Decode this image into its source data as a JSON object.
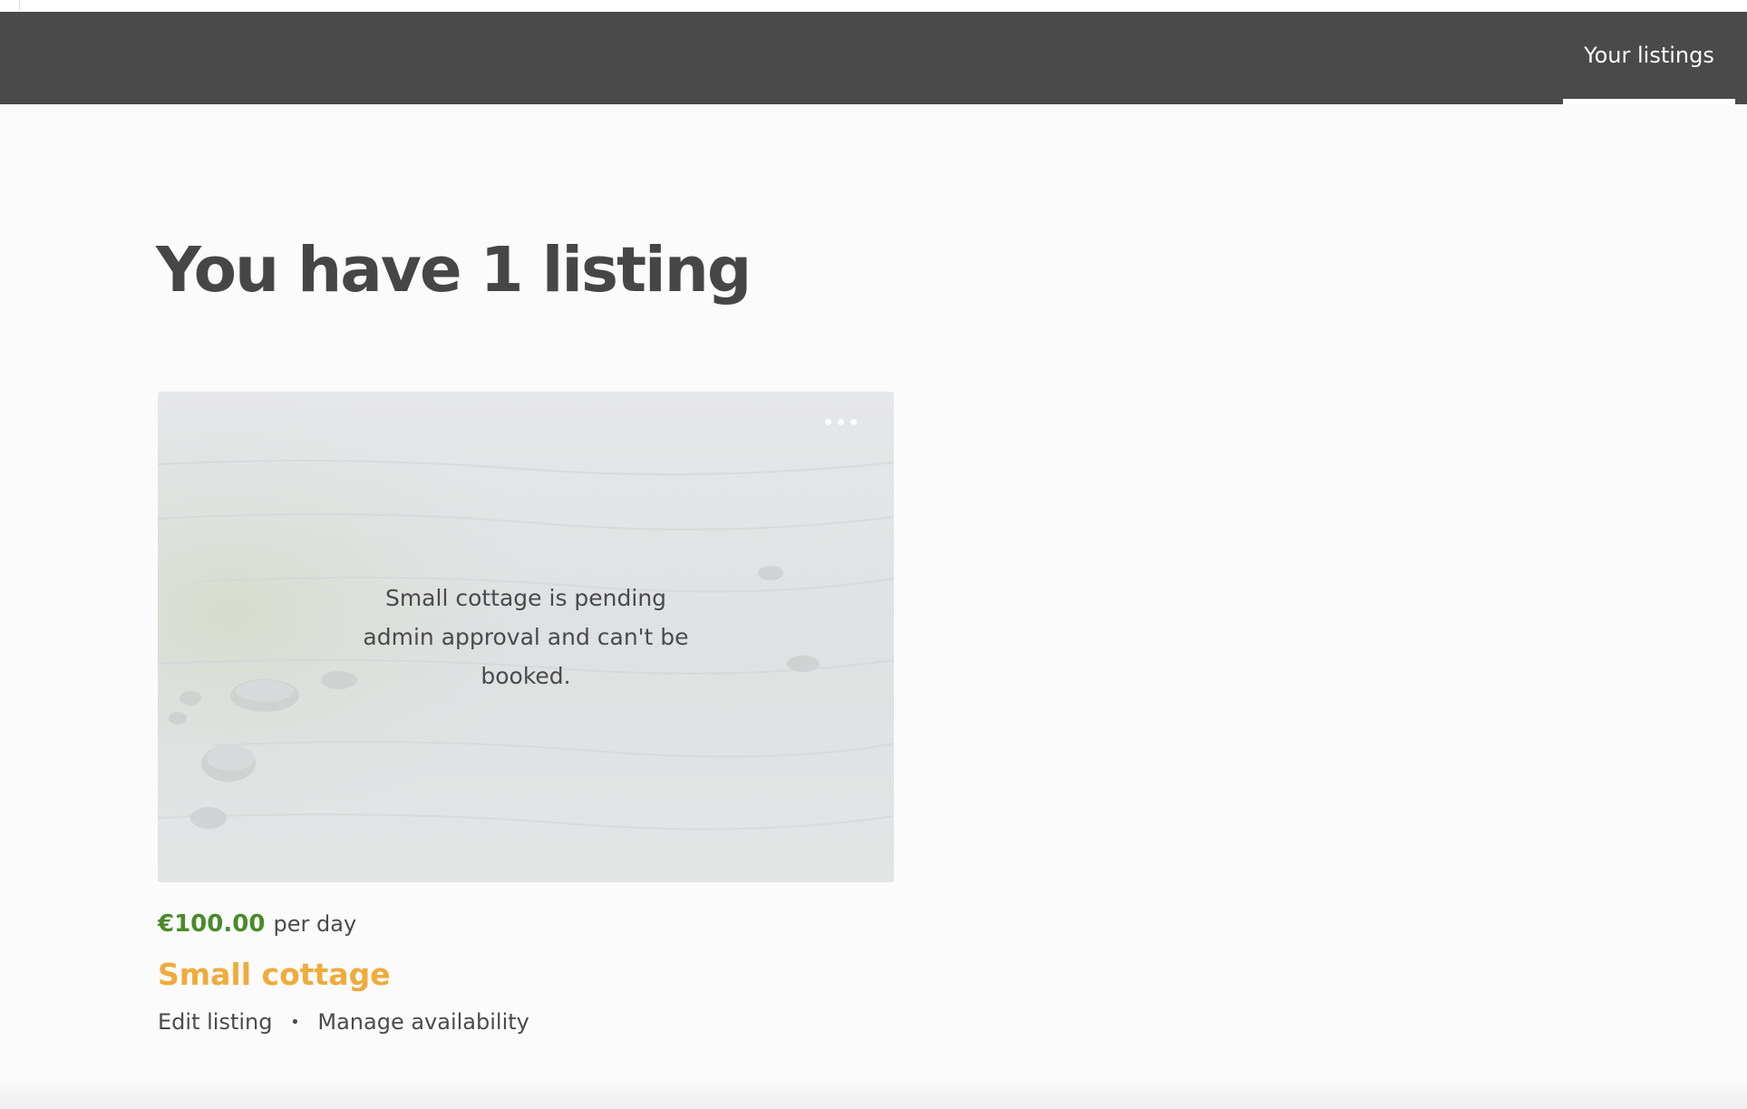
{
  "topbar": {
    "active_tab": "Your listings",
    "background": "#4a4a4a"
  },
  "main": {
    "heading": "You have 1 listing"
  },
  "listing": {
    "status_message": "Small cottage is pending admin approval and can't be booked.",
    "price": "€100.00",
    "price_unit": "per day",
    "title": "Small cottage",
    "edit_label": "Edit listing",
    "separator": "•",
    "availability_label": "Manage availability",
    "menu_icon": "more-dots-icon"
  },
  "colors": {
    "price": "#4a8a2a",
    "title": "#f0ab3c",
    "text": "#4a4a4a",
    "page_bg": "#fbfbfb"
  }
}
